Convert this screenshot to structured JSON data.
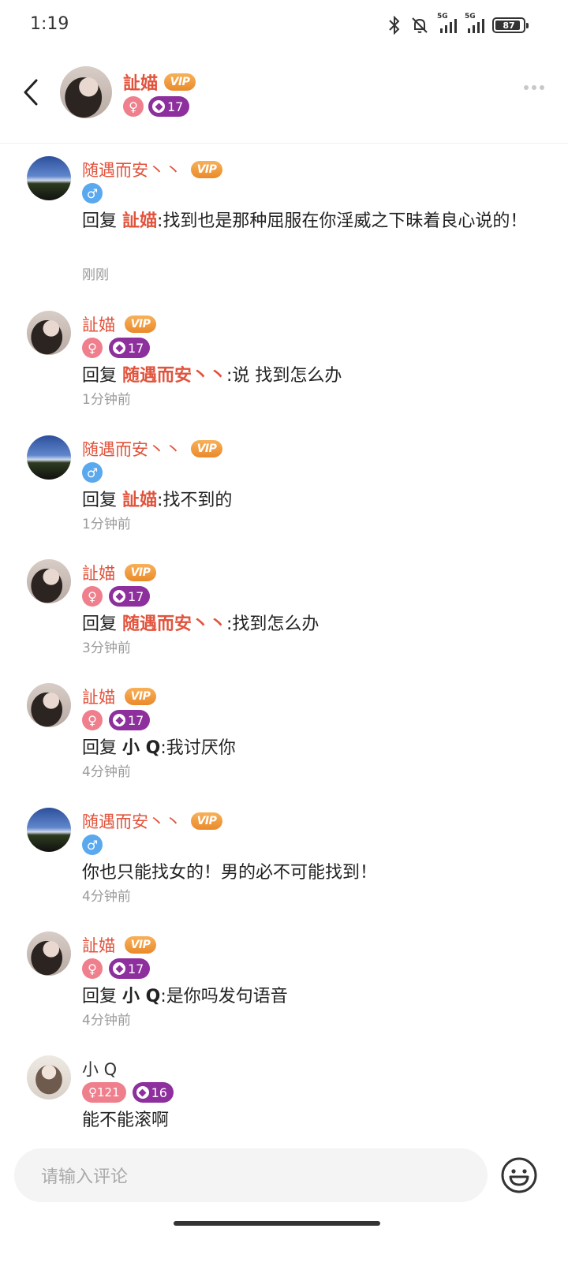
{
  "status_bar": {
    "time": "1:19",
    "sim1_label": "5G",
    "sim2_label": "5G",
    "battery": "87"
  },
  "header": {
    "name": "訨媌",
    "vip_label": "VIP",
    "gender_symbol": "♀",
    "level": "17"
  },
  "comments": [
    {
      "name": "随遇而安丶丶",
      "vip": "VIP",
      "gender": "♂",
      "reply_prefix": "回复 ",
      "reply_target": "訨媌",
      "body": ":找到也是那种屈服在你淫威之下昧着良心说的！",
      "time": "刚刚"
    },
    {
      "name": "訨媌",
      "vip": "VIP",
      "gender": "♀",
      "level": "17",
      "reply_prefix": "回复 ",
      "reply_target": "随遇而安丶丶",
      "body": ":说 找到怎么办",
      "time": "1分钟前"
    },
    {
      "name": "随遇而安丶丶",
      "vip": "VIP",
      "gender": "♂",
      "reply_prefix": "回复 ",
      "reply_target": "訨媌",
      "body": ":找不到的",
      "time": "1分钟前"
    },
    {
      "name": "訨媌",
      "vip": "VIP",
      "gender": "♀",
      "level": "17",
      "reply_prefix": "回复 ",
      "reply_target": "随遇而安丶丶",
      "body": ":找到怎么办",
      "time": "3分钟前"
    },
    {
      "name": "訨媌",
      "vip": "VIP",
      "gender": "♀",
      "level": "17",
      "reply_prefix": "回复 ",
      "reply_target": "小 Q",
      "body": ":我讨厌你",
      "time": "4分钟前"
    },
    {
      "name": "随遇而安丶丶",
      "vip": "VIP",
      "gender": "♂",
      "body": "你也只能找女的！男的必不可能找到！",
      "time": "4分钟前"
    },
    {
      "name": "訨媌",
      "vip": "VIP",
      "gender": "♀",
      "level": "17",
      "reply_prefix": "回复 ",
      "reply_target": "小 Q",
      "body": ":是你吗发句语音",
      "time": "4分钟前"
    },
    {
      "name": "小 Q",
      "gender": "♀121",
      "level": "16",
      "body": "能不能滚啊"
    }
  ],
  "input": {
    "placeholder": "请输入评论"
  }
}
